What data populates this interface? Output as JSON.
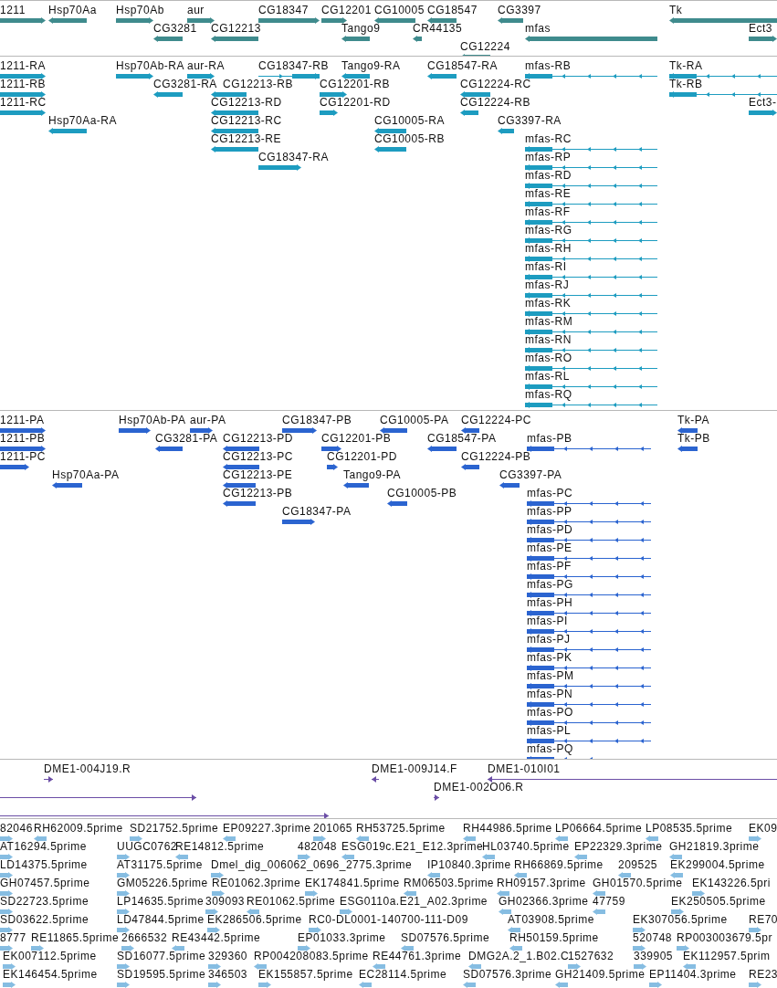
{
  "tracks": [
    {
      "kind": "gene",
      "features": [
        {
          "label": "1211",
          "reverse": false
        },
        {
          "label": "Hsp70Aa",
          "reverse": true
        },
        {
          "label": "Hsp70Ab",
          "reverse": false
        },
        {
          "label": "aur",
          "reverse": false
        },
        {
          "label": "CG18347",
          "reverse": false
        },
        {
          "label": "CG12201",
          "reverse": false
        },
        {
          "label": "CG10005",
          "reverse": true
        },
        {
          "label": "CG18547",
          "reverse": true
        },
        {
          "label": "CG3397",
          "reverse": true
        },
        {
          "label": "Tk",
          "reverse": true
        },
        {
          "label": "CG3281",
          "reverse": true
        },
        {
          "label": "CG12213",
          "reverse": true
        },
        {
          "label": "Tango9",
          "reverse": true
        },
        {
          "label": "CR44135",
          "reverse": true
        },
        {
          "label": "mfas",
          "reverse": true
        },
        {
          "label": "Ect3",
          "reverse": false
        },
        {
          "label": "CG12224",
          "reverse": true
        }
      ]
    },
    {
      "kind": "transcript",
      "features": [
        {
          "label": "1211-RA",
          "reverse": false
        },
        {
          "label": "Hsp70Ab-RA",
          "reverse": false
        },
        {
          "label": "aur-RA",
          "reverse": false
        },
        {
          "label": "CG18347-RB",
          "reverse": false
        },
        {
          "label": "Tango9-RA",
          "reverse": true
        },
        {
          "label": "CG18547-RA",
          "reverse": true
        },
        {
          "label": "mfas-RB",
          "reverse": true
        },
        {
          "label": "Tk-RA",
          "reverse": true
        },
        {
          "label": "1211-RB",
          "reverse": false
        },
        {
          "label": "CG3281-RA",
          "reverse": true
        },
        {
          "label": "CG12213-RB",
          "reverse": true
        },
        {
          "label": "CG12201-RB",
          "reverse": false
        },
        {
          "label": "CG12224-RC",
          "reverse": true
        },
        {
          "label": "Tk-RB",
          "reverse": true
        },
        {
          "label": "1211-RC",
          "reverse": false
        },
        {
          "label": "CG12213-RD",
          "reverse": true
        },
        {
          "label": "CG12201-RD",
          "reverse": false
        },
        {
          "label": "CG12224-RB",
          "reverse": true
        },
        {
          "label": "Ect3-",
          "reverse": false
        },
        {
          "label": "Hsp70Aa-RA",
          "reverse": true
        },
        {
          "label": "CG12213-RC",
          "reverse": true
        },
        {
          "label": "CG10005-RA",
          "reverse": true
        },
        {
          "label": "CG3397-RA",
          "reverse": true
        },
        {
          "label": "CG12213-RE",
          "reverse": true
        },
        {
          "label": "CG10005-RB",
          "reverse": true
        },
        {
          "label": "mfas-RC",
          "reverse": true
        },
        {
          "label": "CG18347-RA",
          "reverse": false
        },
        {
          "label": "mfas-RP",
          "reverse": true
        },
        {
          "label": "mfas-RD",
          "reverse": true
        },
        {
          "label": "mfas-RE",
          "reverse": true
        },
        {
          "label": "mfas-RF",
          "reverse": true
        },
        {
          "label": "mfas-RG",
          "reverse": true
        },
        {
          "label": "mfas-RH",
          "reverse": true
        },
        {
          "label": "mfas-RI",
          "reverse": true
        },
        {
          "label": "mfas-RJ",
          "reverse": true
        },
        {
          "label": "mfas-RK",
          "reverse": true
        },
        {
          "label": "mfas-RM",
          "reverse": true
        },
        {
          "label": "mfas-RN",
          "reverse": true
        },
        {
          "label": "mfas-RO",
          "reverse": true
        },
        {
          "label": "mfas-RL",
          "reverse": true
        },
        {
          "label": "mfas-RQ",
          "reverse": true
        }
      ]
    },
    {
      "kind": "protein",
      "features": [
        {
          "label": "1211-PA",
          "reverse": false
        },
        {
          "label": "Hsp70Ab-PA",
          "reverse": false
        },
        {
          "label": "aur-PA",
          "reverse": false
        },
        {
          "label": "CG18347-PB",
          "reverse": false
        },
        {
          "label": "CG10005-PA",
          "reverse": true
        },
        {
          "label": "CG12224-PC",
          "reverse": true
        },
        {
          "label": "Tk-PA",
          "reverse": true
        },
        {
          "label": "1211-PB",
          "reverse": false
        },
        {
          "label": "CG3281-PA",
          "reverse": true
        },
        {
          "label": "CG12213-PD",
          "reverse": true
        },
        {
          "label": "CG12201-PB",
          "reverse": false
        },
        {
          "label": "CG18547-PA",
          "reverse": true
        },
        {
          "label": "mfas-PB",
          "reverse": true
        },
        {
          "label": "Tk-PB",
          "reverse": true
        },
        {
          "label": "1211-PC",
          "reverse": false
        },
        {
          "label": "CG12213-PC",
          "reverse": true
        },
        {
          "label": "CG12201-PD",
          "reverse": false
        },
        {
          "label": "CG12224-PB",
          "reverse": true
        },
        {
          "label": "Hsp70Aa-PA",
          "reverse": true
        },
        {
          "label": "CG12213-PE",
          "reverse": true
        },
        {
          "label": "Tango9-PA",
          "reverse": true
        },
        {
          "label": "CG3397-PA",
          "reverse": true
        },
        {
          "label": "CG12213-PB",
          "reverse": true
        },
        {
          "label": "CG10005-PB",
          "reverse": true
        },
        {
          "label": "mfas-PC",
          "reverse": true
        },
        {
          "label": "CG18347-PA",
          "reverse": false
        },
        {
          "label": "mfas-PP",
          "reverse": true
        },
        {
          "label": "mfas-PD",
          "reverse": true
        },
        {
          "label": "mfas-PE",
          "reverse": true
        },
        {
          "label": "mfas-PF",
          "reverse": true
        },
        {
          "label": "mfas-PG",
          "reverse": true
        },
        {
          "label": "mfas-PH",
          "reverse": true
        },
        {
          "label": "mfas-PI",
          "reverse": true
        },
        {
          "label": "mfas-PJ",
          "reverse": true
        },
        {
          "label": "mfas-PK",
          "reverse": true
        },
        {
          "label": "mfas-PM",
          "reverse": true
        },
        {
          "label": "mfas-PN",
          "reverse": true
        },
        {
          "label": "mfas-PO",
          "reverse": true
        },
        {
          "label": "mfas-PL",
          "reverse": true
        },
        {
          "label": "mfas-PQ",
          "reverse": true
        }
      ]
    },
    {
      "kind": "clone",
      "features": [
        {
          "label": "DME1-004J19.R",
          "reverse": false
        },
        {
          "label": "DME1-009J14.F",
          "reverse": true
        },
        {
          "label": "DME1-010I01",
          "reverse": true
        },
        {
          "label": "DME1-002O06.R",
          "reverse": false
        },
        {
          "reverse": false
        },
        {
          "reverse": false
        }
      ]
    },
    {
      "kind": "est",
      "features": [
        {
          "label": "82046",
          "reverse": false
        },
        {
          "label": "RH62009.5prime",
          "reverse": true
        },
        {
          "label": "SD21752.5prime",
          "reverse": false
        },
        {
          "label": "EP09227.3prime",
          "reverse": true
        },
        {
          "label": "201065",
          "reverse": false
        },
        {
          "label": "RH53725.5prime",
          "reverse": true
        },
        {
          "label": "RH44986.5prime",
          "reverse": true
        },
        {
          "label": "LP06664.5prime",
          "reverse": true
        },
        {
          "label": "LP08535.5prime",
          "reverse": true
        },
        {
          "label": "EK09",
          "reverse": false
        },
        {
          "label": "AT16294.5prime",
          "reverse": false
        },
        {
          "label": "UUGC0762",
          "reverse": false
        },
        {
          "label": "RE14812.5prime",
          "reverse": true
        },
        {
          "label": "482048",
          "reverse": false
        },
        {
          "label": "ESG019c.E21_E12.3prime",
          "reverse": true
        },
        {
          "label": "HL03740.5prime",
          "reverse": true
        },
        {
          "label": "EP22329.3prime",
          "reverse": true
        },
        {
          "label": "GH21819.3prime",
          "reverse": true
        },
        {
          "label": "LD14375.5prime",
          "reverse": false
        },
        {
          "label": "AT31175.5prime",
          "reverse": false
        },
        {
          "label": "Dmel_dig_006062_0696_2775.3prime",
          "reverse": false
        },
        {
          "label": "IP10840.3prime",
          "reverse": true
        },
        {
          "label": "RH66869.5prime",
          "reverse": true
        },
        {
          "label": "209525",
          "reverse": true
        },
        {
          "label": "EK299004.5prime",
          "reverse": true
        },
        {
          "label": "GH07457.5prime",
          "reverse": false
        },
        {
          "label": "GM05226.5prime",
          "reverse": false
        },
        {
          "label": "RE01062.3prime",
          "reverse": false
        },
        {
          "label": "EK174841.5prime",
          "reverse": false
        },
        {
          "label": "RM06503.5prime",
          "reverse": true
        },
        {
          "label": "RH09157.3prime",
          "reverse": true
        },
        {
          "label": "GH01570.5prime",
          "reverse": true
        },
        {
          "label": "EK143226.5pri",
          "reverse": false
        },
        {
          "label": "SD22723.5prime",
          "reverse": false
        },
        {
          "label": "LP14635.5prime",
          "reverse": false
        },
        {
          "label": "309093",
          "reverse": false
        },
        {
          "label": "RE01062.5prime",
          "reverse": true
        },
        {
          "label": "ESG0110a.E21_A02.3prime",
          "reverse": false
        },
        {
          "label": "GH02366.3prime",
          "reverse": true
        },
        {
          "label": "47759",
          "reverse": true
        },
        {
          "label": "EK250505.5prime",
          "reverse": false
        },
        {
          "label": "SD03622.5prime",
          "reverse": false
        },
        {
          "label": "LD47844.5prime",
          "reverse": false
        },
        {
          "label": "EK286506.5prime",
          "reverse": false
        },
        {
          "label": "RC0-DL0001-140700-111-D09",
          "reverse": false
        },
        {
          "label": "AT03908.5prime",
          "reverse": true
        },
        {
          "label": "EK307056.5prime",
          "reverse": false
        },
        {
          "label": "RE70",
          "reverse": false
        },
        {
          "label": "8777",
          "reverse": false
        },
        {
          "label": "RE11865.5prime",
          "reverse": false
        },
        {
          "label": "2666532",
          "reverse": false
        },
        {
          "label": "RE43442.5prime",
          "reverse": true
        },
        {
          "label": "EP01033.3prime",
          "reverse": false
        },
        {
          "label": "SD07576.5prime",
          "reverse": true
        },
        {
          "label": "RH50159.5prime",
          "reverse": true
        },
        {
          "label": "520748",
          "reverse": false
        },
        {
          "label": "RP003003679.5pr",
          "reverse": false
        },
        {
          "label": "EK007112.5prime",
          "reverse": false
        },
        {
          "label": "SD16077.5prime",
          "reverse": false
        },
        {
          "label": "329360",
          "reverse": false
        },
        {
          "label": "RP004208083.5prime",
          "reverse": true
        },
        {
          "label": "RE44761.3prime",
          "reverse": true
        },
        {
          "label": "DMG2A.2_1.B02.C",
          "reverse": true
        },
        {
          "label": "1527632",
          "reverse": false
        },
        {
          "label": "339905",
          "reverse": false
        },
        {
          "label": "EK112957.5prim",
          "reverse": true
        },
        {
          "label": "EK146454.5prime",
          "reverse": false
        },
        {
          "label": "SD19595.5prime",
          "reverse": false
        },
        {
          "label": "346503",
          "reverse": false
        },
        {
          "label": "EK155857.5prime",
          "reverse": false
        },
        {
          "label": "EC28114.5prime",
          "reverse": true
        },
        {
          "label": "SD07576.3prime",
          "reverse": true
        },
        {
          "label": "GH21409.5prime",
          "reverse": true
        },
        {
          "label": "EP11404.3prime",
          "reverse": false
        },
        {
          "label": "RE23",
          "reverse": false
        }
      ]
    }
  ]
}
